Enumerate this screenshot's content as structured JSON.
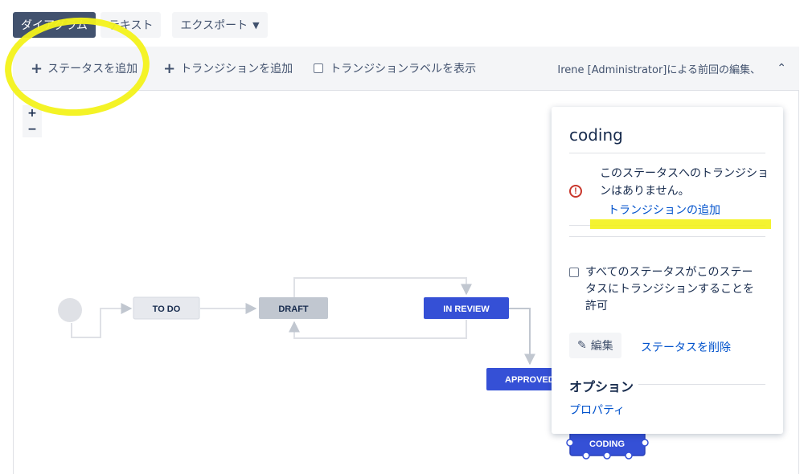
{
  "view_tabs": {
    "diagram": "ダイアグラム",
    "text": "テキスト",
    "export": "エクスポート"
  },
  "toolbar": {
    "add_status": "ステータスを追加",
    "add_transition": "トランジションを追加",
    "show_transition_labels": "トランジションラベルを表示",
    "last_edited": "Irene [Administrator]による前回の編集、"
  },
  "zoom": {
    "in": "+",
    "out": "−"
  },
  "diagram": {
    "nodes": {
      "todo": "TO DO",
      "draft": "DRAFT",
      "in_review": "IN REVIEW",
      "approved": "APPROVED",
      "coding": "CODING"
    }
  },
  "panel": {
    "title": "coding",
    "warning_text": "このステータスへのトランジションはありません。",
    "add_transition_link": "トランジションの追加",
    "allow_all_label": "すべてのステータスがこのステータスにトランジションすることを許可",
    "edit_button": "編集",
    "delete_link": "ステータスを削除",
    "options_title": "オプション",
    "properties_link": "プロパティ"
  },
  "colors": {
    "primary_blue": "#3550d6",
    "highlight_yellow": "#f3f21a",
    "draft_gray": "#c1c7d0",
    "warning_red": "#c9372c"
  }
}
